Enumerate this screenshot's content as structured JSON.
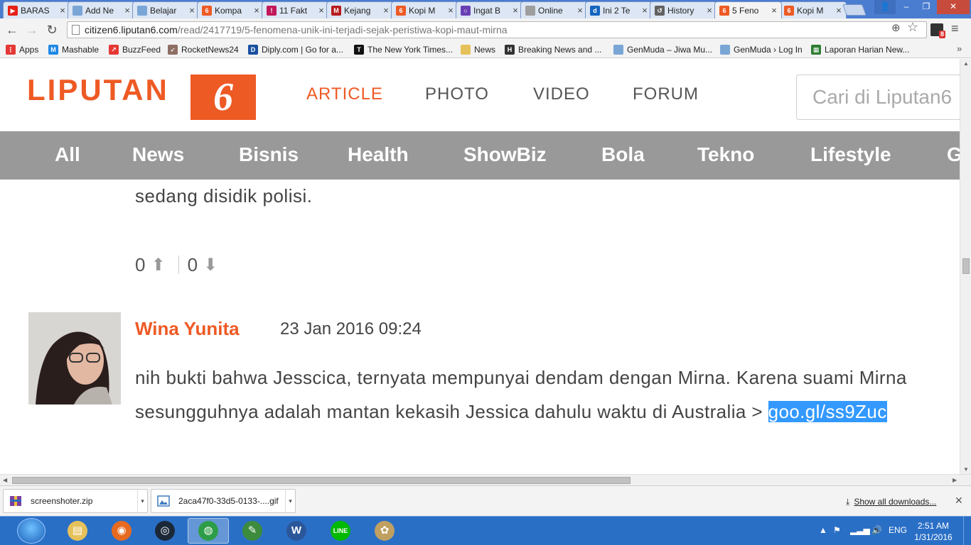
{
  "browser": {
    "tabs": [
      {
        "label": "BARAS",
        "icon": "youtube-icon",
        "color": "#e62117",
        "glyph": "▶"
      },
      {
        "label": "Add Ne",
        "icon": "page-icon",
        "color": "#7aa6d6",
        "glyph": ""
      },
      {
        "label": "Belajar",
        "icon": "page-icon",
        "color": "#7aa6d6",
        "glyph": ""
      },
      {
        "label": "Kompa",
        "icon": "liputan6-icon",
        "color": "#ee5a24",
        "glyph": "6"
      },
      {
        "label": "11 Fakt",
        "icon": "pin-icon",
        "color": "#c2185b",
        "glyph": "!"
      },
      {
        "label": "Kejang",
        "icon": "m-icon",
        "color": "#b71c1c",
        "glyph": "M"
      },
      {
        "label": "Kopi M",
        "icon": "liputan6-icon",
        "color": "#ee5a24",
        "glyph": "6"
      },
      {
        "label": "Ingat B",
        "icon": "circle-icon",
        "color": "#6a3fb5",
        "glyph": "○"
      },
      {
        "label": "Online",
        "icon": "page-icon",
        "color": "#9e9e9e",
        "glyph": ""
      },
      {
        "label": "Ini 2 Te",
        "icon": "d-icon",
        "color": "#1565c0",
        "glyph": "d"
      },
      {
        "label": "History",
        "icon": "history-icon",
        "color": "#616161",
        "glyph": "↺"
      },
      {
        "label": "5 Feno",
        "icon": "liputan6-icon",
        "color": "#ee5a24",
        "glyph": "6",
        "active": true
      },
      {
        "label": "Kopi M",
        "icon": "liputan6-icon",
        "color": "#ee5a24",
        "glyph": "6"
      }
    ],
    "url_host": "citizen6.liputan6.com",
    "url_path": "/read/2417719/5-fenomena-unik-ini-terjadi-sejak-peristiwa-kopi-maut-mirna",
    "extension_badge": "8",
    "bookmarks": [
      {
        "label": "Apps",
        "icon": "apps-grid-icon",
        "color": "#e53935",
        "glyph": "⋮"
      },
      {
        "label": "Mashable",
        "icon": "mashable-icon",
        "color": "#1e88e5",
        "glyph": "M"
      },
      {
        "label": "BuzzFeed",
        "icon": "buzzfeed-icon",
        "color": "#e53935",
        "glyph": "↗"
      },
      {
        "label": "RocketNews24",
        "icon": "rocket-icon",
        "color": "#8d6e63",
        "glyph": "➶"
      },
      {
        "label": "Diply.com | Go for a...",
        "icon": "diply-icon",
        "color": "#1a4fa0",
        "glyph": "D"
      },
      {
        "label": "The New York Times...",
        "icon": "nyt-icon",
        "color": "#111111",
        "glyph": "T"
      },
      {
        "label": "News",
        "icon": "folder-icon",
        "color": "#e6c15a",
        "glyph": ""
      },
      {
        "label": "Breaking News and ...",
        "icon": "h-icon",
        "color": "#333333",
        "glyph": "H"
      },
      {
        "label": "GenMuda – Jiwa Mu...",
        "icon": "genmuda-icon",
        "color": "#7aa6d6",
        "glyph": ""
      },
      {
        "label": "GenMuda › Log In",
        "icon": "genmuda-icon",
        "color": "#7aa6d6",
        "glyph": ""
      },
      {
        "label": "Laporan Harian New...",
        "icon": "sheet-icon",
        "color": "#2e7d32",
        "glyph": "▦"
      }
    ]
  },
  "site": {
    "logo_text": "LIPUTAN",
    "logo_mark": "6",
    "brand_color": "#ee5a24",
    "main_nav": [
      {
        "label": "ARTICLE",
        "active": true
      },
      {
        "label": "PHOTO"
      },
      {
        "label": "VIDEO"
      },
      {
        "label": "FORUM"
      }
    ],
    "search_placeholder": "Cari di Liputan6",
    "categories": [
      "All",
      "News",
      "Bisnis",
      "Health",
      "ShowBiz",
      "Bola",
      "Tekno",
      "Lifestyle",
      "G"
    ]
  },
  "content": {
    "previous_comment_tail": "sedang disidik polisi.",
    "upvotes": "0",
    "downvotes": "0",
    "comment": {
      "author": "Wina Yunita",
      "date": "23 Jan 2016 09:24",
      "text": "nih bukti bahwa Jesscica, ternyata mempunyai dendam dengan Mirna. Karena suami Mirna sesungguhnya adalah mantan kekasih Jessica dahulu waktu di Australia > ",
      "link": "goo.gl/ss9Zuc"
    }
  },
  "downloads": {
    "items": [
      {
        "name": "screenshoter.zip",
        "icon": "zip-archive-icon"
      },
      {
        "name": "2aca47f0-33d5-0133-....gif",
        "icon": "image-file-icon"
      }
    ],
    "show_all": "Show all downloads..."
  },
  "taskbar": {
    "apps": [
      {
        "name": "explorer",
        "icon": "folder-icon",
        "color": "#e6c15a",
        "glyph": "▤"
      },
      {
        "name": "firefox",
        "icon": "firefox-icon",
        "color": "#e66a1f",
        "glyph": "◉"
      },
      {
        "name": "steam",
        "icon": "steam-icon",
        "color": "#1b2838",
        "glyph": "◎"
      },
      {
        "name": "chrome",
        "icon": "chrome-icon",
        "color": "#2e9d48",
        "glyph": "◍",
        "active": true
      },
      {
        "name": "notepad",
        "icon": "notepad-icon",
        "color": "#3d8b3d",
        "glyph": "✎"
      },
      {
        "name": "word",
        "icon": "word-icon",
        "color": "#2b579a",
        "glyph": "W"
      },
      {
        "name": "line",
        "icon": "line-icon",
        "color": "#00b900",
        "glyph": "LINE"
      },
      {
        "name": "paint",
        "icon": "paint-icon",
        "color": "#c0a060",
        "glyph": "✿"
      }
    ],
    "language": "ENG",
    "time": "2:51 AM",
    "date": "1/31/2016"
  }
}
